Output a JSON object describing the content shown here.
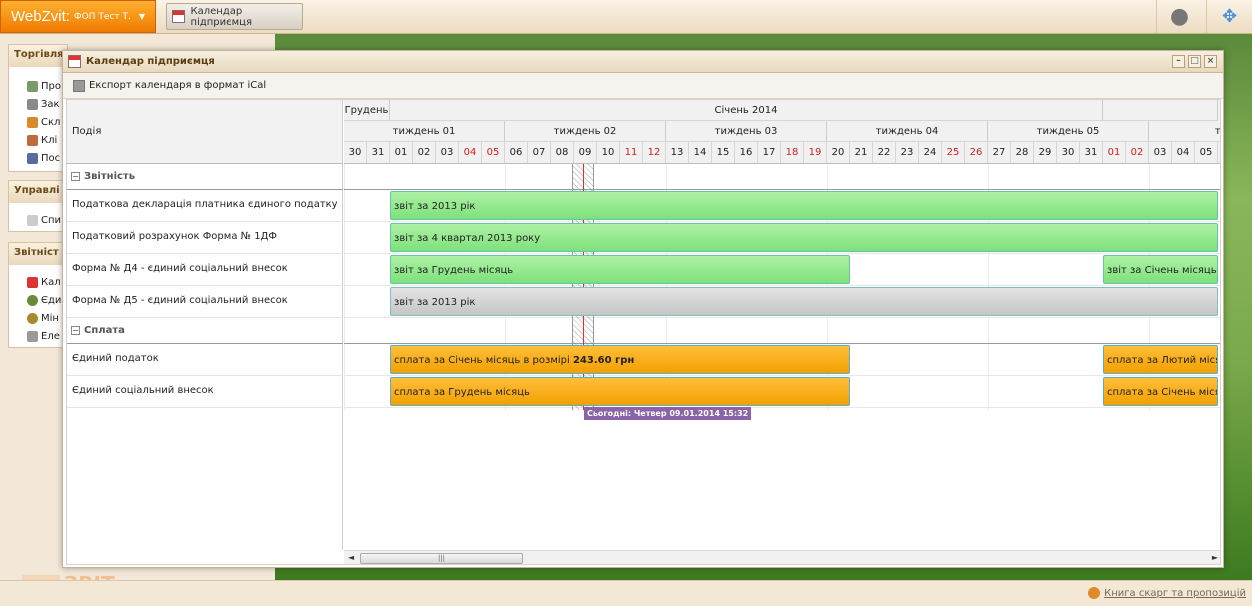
{
  "topbar": {
    "brand": "WebZvit:",
    "user": "ФОП Тест Т.",
    "task_button": "Календар підприємця"
  },
  "sidebar": {
    "sections": [
      {
        "title": "Торгівля",
        "items": [
          "Про",
          "Зак",
          "Скл",
          "Клі",
          "Пос"
        ]
      },
      {
        "title": "Управлі",
        "items": [
          "Спи"
        ]
      },
      {
        "title": "Звітніст",
        "items": [
          "Кал",
          "Єди",
          "Мін",
          "Еле"
        ]
      }
    ]
  },
  "watermark": {
    "a": "WEB",
    "b": "ЗВІТ"
  },
  "window": {
    "title": "Календар підприємця",
    "toolbar_export": "Експорт календаря в формат iCal",
    "event_column_header": "Подія",
    "months": [
      {
        "label": "Грудень"
      },
      {
        "label": "Січень 2014"
      },
      {
        "label": ""
      }
    ],
    "weeks": [
      "тиждень 01",
      "тиждень 02",
      "тиждень 03",
      "тиждень 04",
      "тиждень 05",
      "тижд"
    ],
    "days": [
      {
        "d": "30",
        "we": false
      },
      {
        "d": "31",
        "we": false
      },
      {
        "d": "01",
        "we": false
      },
      {
        "d": "02",
        "we": false
      },
      {
        "d": "03",
        "we": false
      },
      {
        "d": "04",
        "we": true
      },
      {
        "d": "05",
        "we": true
      },
      {
        "d": "06",
        "we": false
      },
      {
        "d": "07",
        "we": false
      },
      {
        "d": "08",
        "we": false
      },
      {
        "d": "09",
        "we": false
      },
      {
        "d": "10",
        "we": false
      },
      {
        "d": "11",
        "we": true
      },
      {
        "d": "12",
        "we": true
      },
      {
        "d": "13",
        "we": false
      },
      {
        "d": "14",
        "we": false
      },
      {
        "d": "15",
        "we": false
      },
      {
        "d": "16",
        "we": false
      },
      {
        "d": "17",
        "we": false
      },
      {
        "d": "18",
        "we": true
      },
      {
        "d": "19",
        "we": true
      },
      {
        "d": "20",
        "we": false
      },
      {
        "d": "21",
        "we": false
      },
      {
        "d": "22",
        "we": false
      },
      {
        "d": "23",
        "we": false
      },
      {
        "d": "24",
        "we": false
      },
      {
        "d": "25",
        "we": true
      },
      {
        "d": "26",
        "we": true
      },
      {
        "d": "27",
        "we": false
      },
      {
        "d": "28",
        "we": false
      },
      {
        "d": "29",
        "we": false
      },
      {
        "d": "30",
        "we": false
      },
      {
        "d": "31",
        "we": false
      },
      {
        "d": "01",
        "we": true
      },
      {
        "d": "02",
        "we": true
      },
      {
        "d": "03",
        "we": false
      },
      {
        "d": "04",
        "we": false
      },
      {
        "d": "05",
        "we": false
      }
    ],
    "groups": [
      {
        "label": "Звітність",
        "events": [
          "Податкова декларація платника єдиного податку",
          "Податковий розрахунок Форма № 1ДФ",
          "Форма № Д4 - єдиний соціальний внесок",
          "Форма № Д5 - єдиний соціальний внесок"
        ]
      },
      {
        "label": "Сплата",
        "events": [
          "Єдиний податок",
          "Єдиний соціальний внесок"
        ]
      }
    ],
    "bars": [
      {
        "row": 0,
        "start": 2,
        "end": 38,
        "color": "g",
        "label": "звіт за 2013 рік"
      },
      {
        "row": 1,
        "start": 2,
        "end": 38,
        "color": "g",
        "label": "звіт за 4 квартал 2013 року"
      },
      {
        "row": 2,
        "start": 2,
        "end": 22,
        "color": "g",
        "label": "звіт за Грудень місяць"
      },
      {
        "row": 2,
        "start": 33,
        "end": 38,
        "color": "g",
        "label": "звіт за Січень місяць"
      },
      {
        "row": 3,
        "start": 2,
        "end": 38,
        "color": "s",
        "label": "звіт за 2013 рік"
      },
      {
        "row": 4,
        "start": 2,
        "end": 22,
        "color": "o",
        "label": "сплата за Січень місяць в розмірі ",
        "bold": "243.60 грн"
      },
      {
        "row": 4,
        "start": 33,
        "end": 38,
        "color": "o",
        "label": "сплата за Лютий місяць в"
      },
      {
        "row": 5,
        "start": 2,
        "end": 22,
        "color": "o",
        "label": "сплата за Грудень місяць"
      },
      {
        "row": 5,
        "start": 33,
        "end": 38,
        "color": "o",
        "label": "сплата за Січень місяць"
      }
    ],
    "today_label": "Сьогодні: Четвер 09.01.2014 15:32"
  },
  "footer": {
    "link": "Книга скарг та пропозицій"
  },
  "colors": {
    "brand": "#f07b00",
    "bar_green": "#7ee07a",
    "bar_orange": "#f3a000",
    "bar_gray": "#c5c5c5",
    "today": "#8a63a8"
  }
}
